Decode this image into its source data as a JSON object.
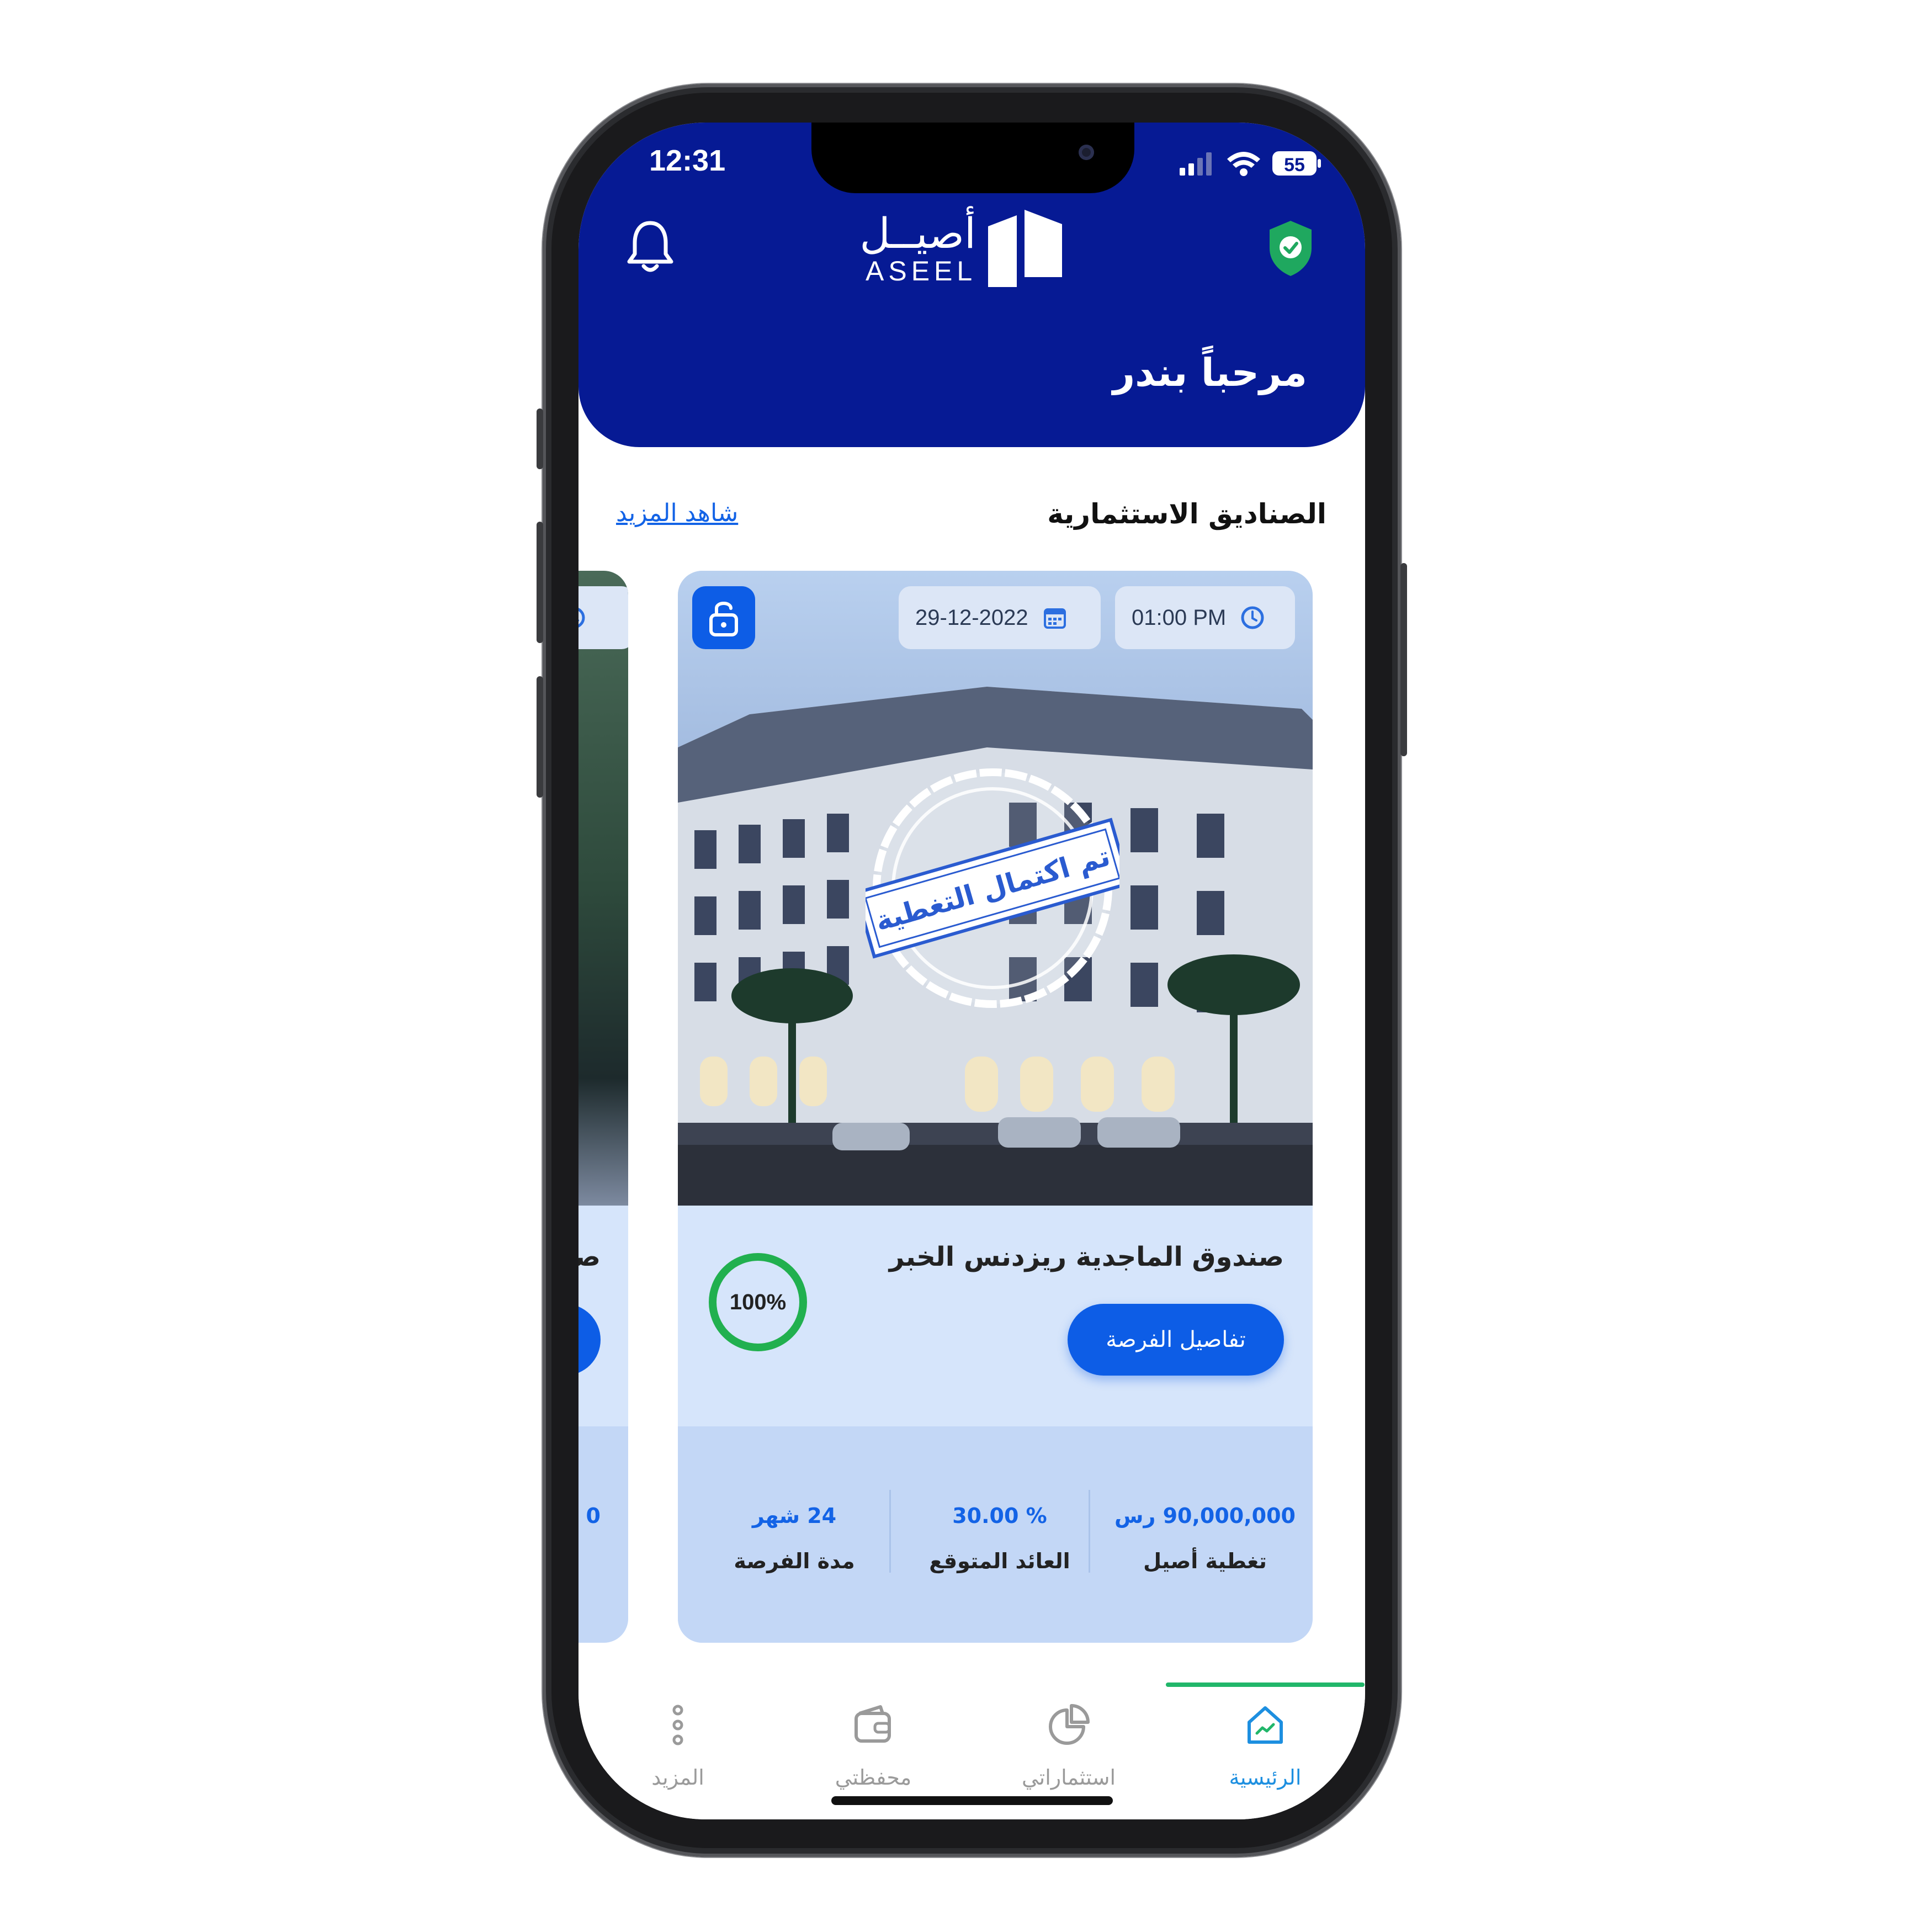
{
  "status_bar": {
    "time": "12:31",
    "battery": "55"
  },
  "header": {
    "logo_ar": "أصيــل",
    "logo_en": "ASEEL",
    "welcome": "مرحباً بندر"
  },
  "section": {
    "title": "الصناديق الاستثمارية",
    "see_more": "شاهد المزيد"
  },
  "card": {
    "time": "01:00 PM",
    "date": "29-12-2022",
    "stamp_text": "تم اكتمال التغطية",
    "fund_name": "صندوق الماجدية  ريزدنس  الخبر",
    "details_button": "تفاصيل الفرصة",
    "progress_label": "100%",
    "progress": 1.0,
    "stats": [
      {
        "value": "90,000,000 رس",
        "label": "تغطية أصيل"
      },
      {
        "value": "%  30.00",
        "label": "العائد المتوقع"
      },
      {
        "value": "24 شهر",
        "label": "مدة الفرصة"
      }
    ]
  },
  "prev_card": {
    "name_fragment": "صن",
    "stat_fragment": "0"
  },
  "tabs": [
    {
      "label": "الرئيسية",
      "icon": "home-icon",
      "active": true
    },
    {
      "label": "استثماراتي",
      "icon": "pie-chart-icon",
      "active": false
    },
    {
      "label": "محفظتي",
      "icon": "wallet-icon",
      "active": false
    },
    {
      "label": "المزيد",
      "icon": "more-icon",
      "active": false
    }
  ],
  "colors": {
    "brand": "#061a94",
    "accent": "#0d5de6",
    "success": "#21b66a"
  }
}
